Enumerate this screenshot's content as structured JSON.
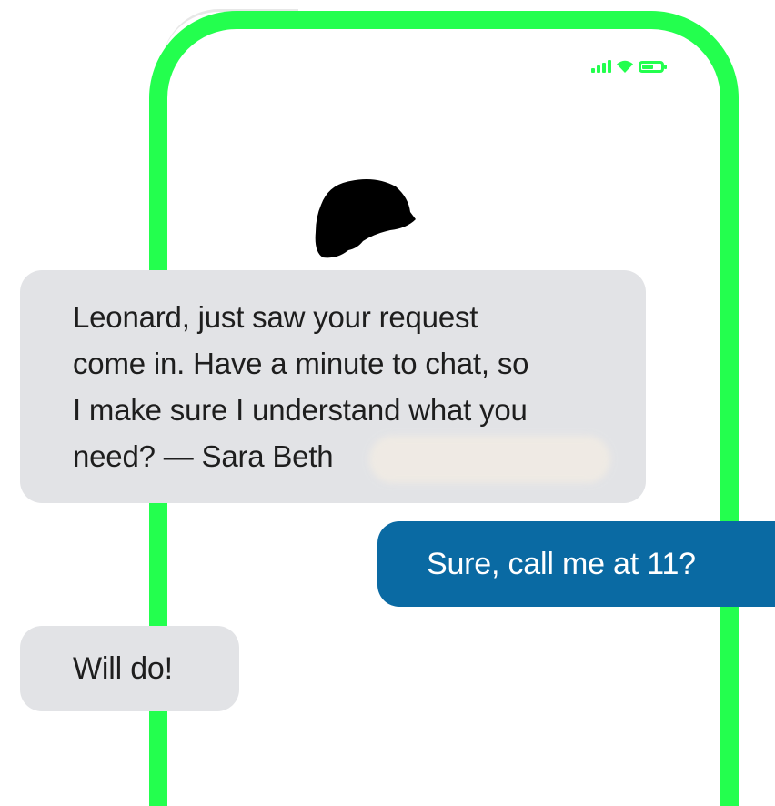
{
  "colors": {
    "phone_frame": "#23ff4e",
    "incoming_bubble": "#e2e3e6",
    "outgoing_bubble": "#0a6aa3",
    "incoming_text": "#1e1e1e",
    "outgoing_text": "#ffffff"
  },
  "status_bar": {
    "icons": [
      "signal-icon",
      "wifi-icon",
      "battery-icon"
    ],
    "battery_level": 0.6
  },
  "contact": {
    "avatar": "redacted-avatar"
  },
  "messages": [
    {
      "direction": "incoming",
      "text": "Leonard, just saw your request\ncome in. Have a minute to chat, so\nI make sure I understand what you\nneed? — Sara Beth"
    },
    {
      "direction": "outgoing",
      "text": "Sure, call me at 11?"
    },
    {
      "direction": "incoming",
      "text": "Will do!"
    }
  ]
}
